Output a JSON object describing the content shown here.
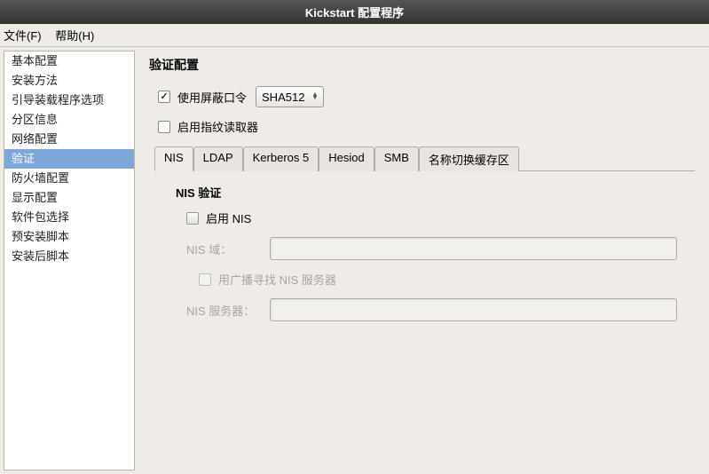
{
  "titlebar": "Kickstart 配置程序",
  "menubar": {
    "file": "文件(F)",
    "help": "帮助(H)"
  },
  "sidebar": {
    "items": [
      {
        "label": "基本配置"
      },
      {
        "label": "安装方法"
      },
      {
        "label": "引导装载程序选项"
      },
      {
        "label": "分区信息"
      },
      {
        "label": "网络配置"
      },
      {
        "label": "验证"
      },
      {
        "label": "防火墙配置"
      },
      {
        "label": "显示配置"
      },
      {
        "label": "软件包选择"
      },
      {
        "label": "预安装脚本"
      },
      {
        "label": "安装后脚本"
      }
    ],
    "selected_index": 5
  },
  "content": {
    "title": "验证配置",
    "shadow_pw": {
      "label": "使用屏蔽口令",
      "checked": true
    },
    "hash_select": {
      "value": "SHA512"
    },
    "fingerprint": {
      "label": "启用指纹读取器",
      "checked": false
    },
    "tabs": [
      {
        "label": "NIS"
      },
      {
        "label": "LDAP"
      },
      {
        "label": "Kerberos 5"
      },
      {
        "label": "Hesiod"
      },
      {
        "label": "SMB"
      },
      {
        "label": "名称切换缓存区"
      }
    ],
    "active_tab": 0,
    "nis": {
      "title": "NIS 验证",
      "enable": {
        "label": "启用 NIS",
        "checked": false
      },
      "domain": {
        "label": "NIS 域：",
        "value": ""
      },
      "broadcast": {
        "label": "用广播寻找 NIS 服务器",
        "checked": false
      },
      "server": {
        "label": "NIS 服务器：",
        "value": ""
      }
    }
  }
}
